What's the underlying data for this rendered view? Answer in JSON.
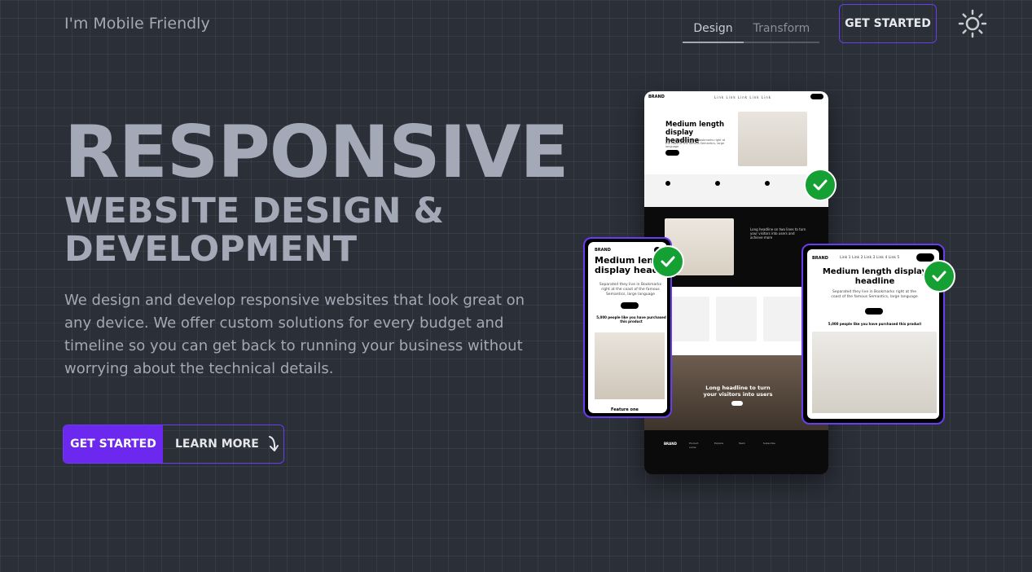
{
  "header": {
    "brand": "I'm Mobile Friendly",
    "tabs": [
      {
        "label": "Design",
        "active": true
      },
      {
        "label": "Transform",
        "active": false
      }
    ],
    "cta_label": "GET STARTED",
    "theme_toggle_icon": "sun-icon"
  },
  "hero": {
    "title_line1": "RESPONSIVE",
    "title_line2": "WEBSITE DESIGN &",
    "title_line3": "DEVELOPMENT",
    "description": "We design and develop responsive websites that look great on any device. We offer custom solutions for every budget and timeline so you can get back to running your business without worrying about the technical details.",
    "primary_cta": "GET STARTED",
    "secondary_cta": "LEARN MORE",
    "secondary_cta_icon": "arrow-down-curve-icon"
  },
  "mockups": {
    "desktop": {
      "brand": "BRAND",
      "nav": "Link Link Link Link Link",
      "headline": "Medium length display headline",
      "subtext": "Separated they live in Bookmarks right at the coast of the famous Semantics, large language",
      "section_headline": "Long headline on two lines to turn your visitors into users and achieve more",
      "photo_headline": "Long headline to turn your visitors into users",
      "footer_brand": "BRAND",
      "footer_cols": [
        "Product name",
        "Explore",
        "Team",
        "Subscribe"
      ]
    },
    "phone": {
      "brand": "BRAND",
      "headline": "Medium length display headline",
      "subtext": "Separated they live in Bookmarks right at the coast of the famous Semantics, large language",
      "proof": "5,000 people like you have purchased this product",
      "feature": "Feature one"
    },
    "tablet": {
      "brand": "BRAND",
      "nav": "Link 1   Link 2   Link 3   Link 4   Link 5",
      "headline": "Medium length display headline",
      "subtext": "Separated they live in Bookmarks right at the coast of the famous Semantics, large language",
      "proof": "5,000 people like you have purchased this product"
    },
    "badge_icon": "check-circle-icon"
  },
  "colors": {
    "background": "#2b2f38",
    "accent": "#6d28ef",
    "check": "#15a034",
    "text": "#a3a9b6"
  }
}
